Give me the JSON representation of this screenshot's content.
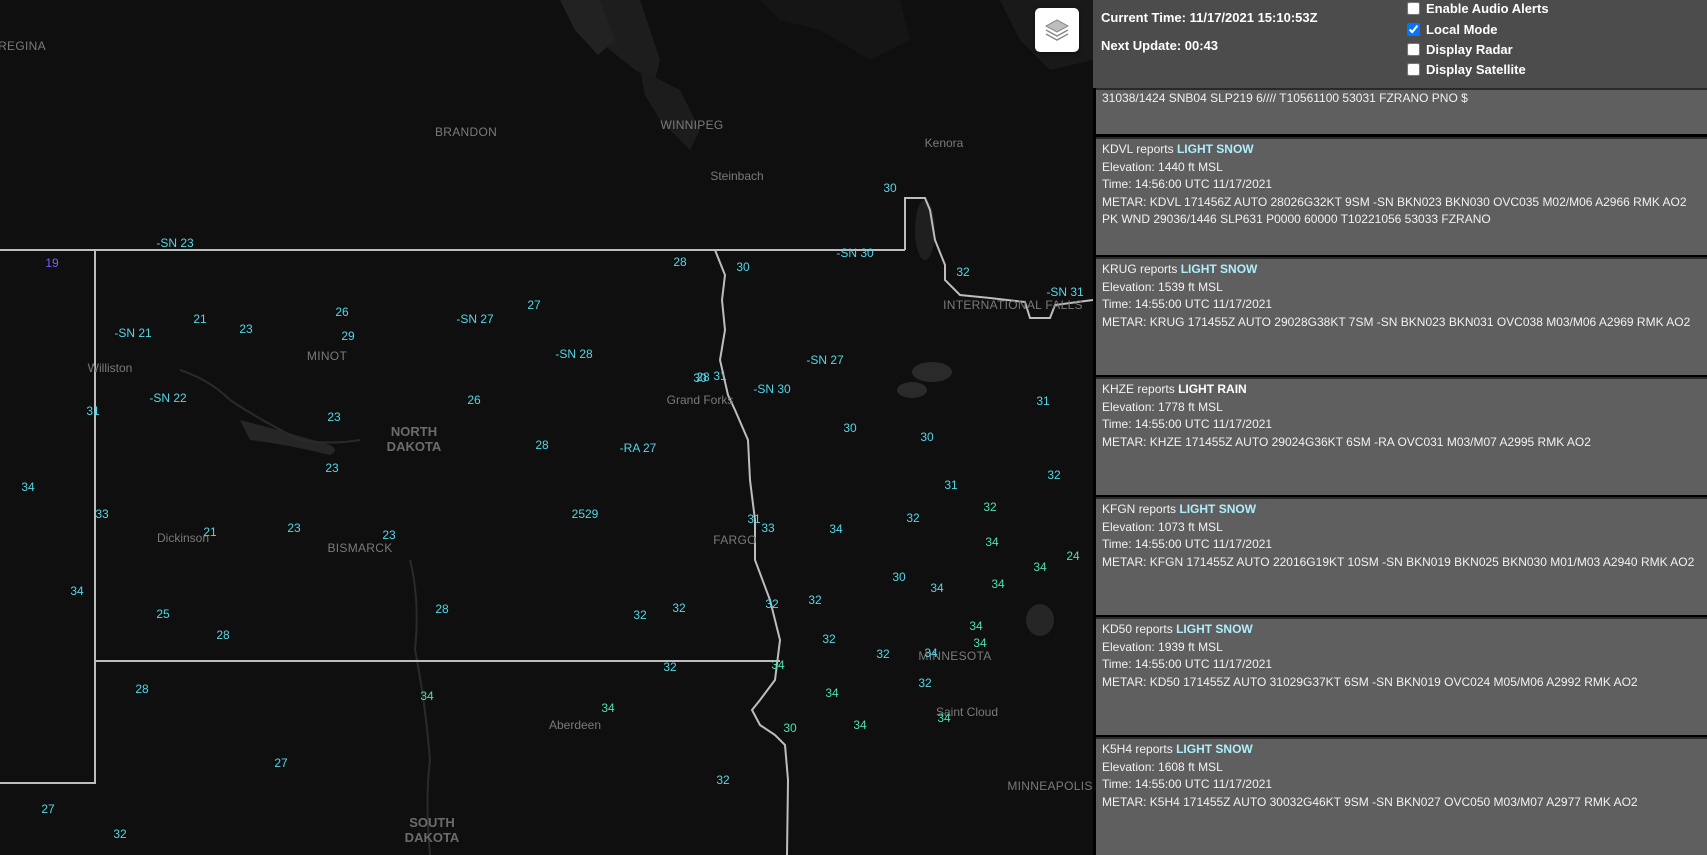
{
  "header": {
    "current_time": "Current Time: 11/17/2021 15:10:53Z",
    "next_update": "Next Update: 00:43",
    "options": [
      {
        "label": "Enable Audio Alerts",
        "checked": false
      },
      {
        "label": "Local Mode",
        "checked": true
      },
      {
        "label": "Display Radar",
        "checked": false
      },
      {
        "label": "Display Satellite",
        "checked": false
      }
    ]
  },
  "map": {
    "places": [
      "REGINA",
      "BRANDON",
      "WINNIPEG",
      "Steinbach",
      "Kenora",
      "INTERNATIONAL FALLS",
      "Williston",
      "MINOT",
      "Grand Forks",
      "NORTH DAKOTA",
      "Dickinson",
      "BISMARCK",
      "FARGO",
      "MINNESOTA",
      "Aberdeen",
      "Saint Cloud",
      "MINNEAPOLIS",
      "SOUTH DAKOTA"
    ],
    "observations": [
      "-SN 23",
      "19",
      "-SN 21",
      "21",
      "23",
      "26",
      "29",
      "-SN 27",
      "27",
      "-SN 28",
      "28",
      "28",
      "30",
      "-SN 30",
      "30",
      "32",
      "-SN 31",
      "31",
      "-SN 22",
      "23",
      "26",
      "-SN 27",
      "-SN 30",
      "30",
      "31",
      "31",
      "34",
      "23",
      "-RA 27",
      "28",
      "30",
      "30",
      "32",
      "33",
      "21",
      "23",
      "23",
      "2529",
      "31",
      "33",
      "34",
      "32",
      "31",
      "32",
      "34",
      "34",
      "24",
      "34",
      "30",
      "34",
      "34",
      "25",
      "28",
      "28",
      "32",
      "32",
      "32",
      "32",
      "32",
      "32",
      "34",
      "34",
      "32",
      "34",
      "28",
      "34",
      "34",
      "34",
      "32",
      "34",
      "34",
      "34",
      "30",
      "32",
      "27",
      "27",
      "32"
    ]
  },
  "feed": {
    "partial": "31038/1424 SNB04 SLP219 6//// T10561100 53031 FZRANO PNO $",
    "cards": [
      {
        "station": "KDVL",
        "reports": "reports",
        "wx": "LIGHT SNOW",
        "elevation": "Elevation: 1440 ft MSL",
        "time": "Time: 14:56:00 UTC 11/17/2021",
        "metar": "METAR: KDVL 171456Z AUTO 28026G32KT 9SM -SN BKN023 BKN030 OVC035 M02/M06 A2966 RMK AO2 PK WND 29036/1446 SLP631 P0000 60000 T10221056 53033 FZRANO"
      },
      {
        "station": "KRUG",
        "reports": "reports",
        "wx": "LIGHT SNOW",
        "elevation": "Elevation: 1539 ft MSL",
        "time": "Time: 14:55:00 UTC 11/17/2021",
        "metar": "METAR: KRUG 171455Z AUTO 29028G38KT 7SM -SN BKN023 BKN031 OVC038 M03/M06 A2969 RMK AO2"
      },
      {
        "station": "KHZE",
        "reports": "reports",
        "wx": "LIGHT RAIN",
        "elevation": "Elevation: 1778 ft MSL",
        "time": "Time: 14:55:00 UTC 11/17/2021",
        "metar": "METAR: KHZE 171455Z AUTO 29024G36KT 6SM -RA OVC031 M03/M07 A2995 RMK AO2"
      },
      {
        "station": "KFGN",
        "reports": "reports",
        "wx": "LIGHT SNOW",
        "elevation": "Elevation: 1073 ft MSL",
        "time": "Time: 14:55:00 UTC 11/17/2021",
        "metar": "METAR: KFGN 171455Z AUTO 22016G19KT 10SM -SN BKN019 BKN025 BKN030 M01/M03 A2940 RMK AO2"
      },
      {
        "station": "KD50",
        "reports": "reports",
        "wx": "LIGHT SNOW",
        "elevation": "Elevation: 1939 ft MSL",
        "time": "Time: 14:55:00 UTC 11/17/2021",
        "metar": "METAR: KD50 171455Z AUTO 31029G37KT 6SM -SN BKN019 OVC024 M05/M06 A2992 RMK AO2"
      },
      {
        "station": "K5H4",
        "reports": "reports",
        "wx": "LIGHT SNOW",
        "elevation": "Elevation: 1608 ft MSL",
        "time": "Time: 14:55:00 UTC 11/17/2021",
        "metar": "METAR: K5H4 171455Z AUTO 30032G46KT 9SM -SN BKN027 OVC050 M03/M07 A2977 RMK AO2"
      }
    ]
  },
  "icons": {
    "layers": "layers-icon"
  }
}
